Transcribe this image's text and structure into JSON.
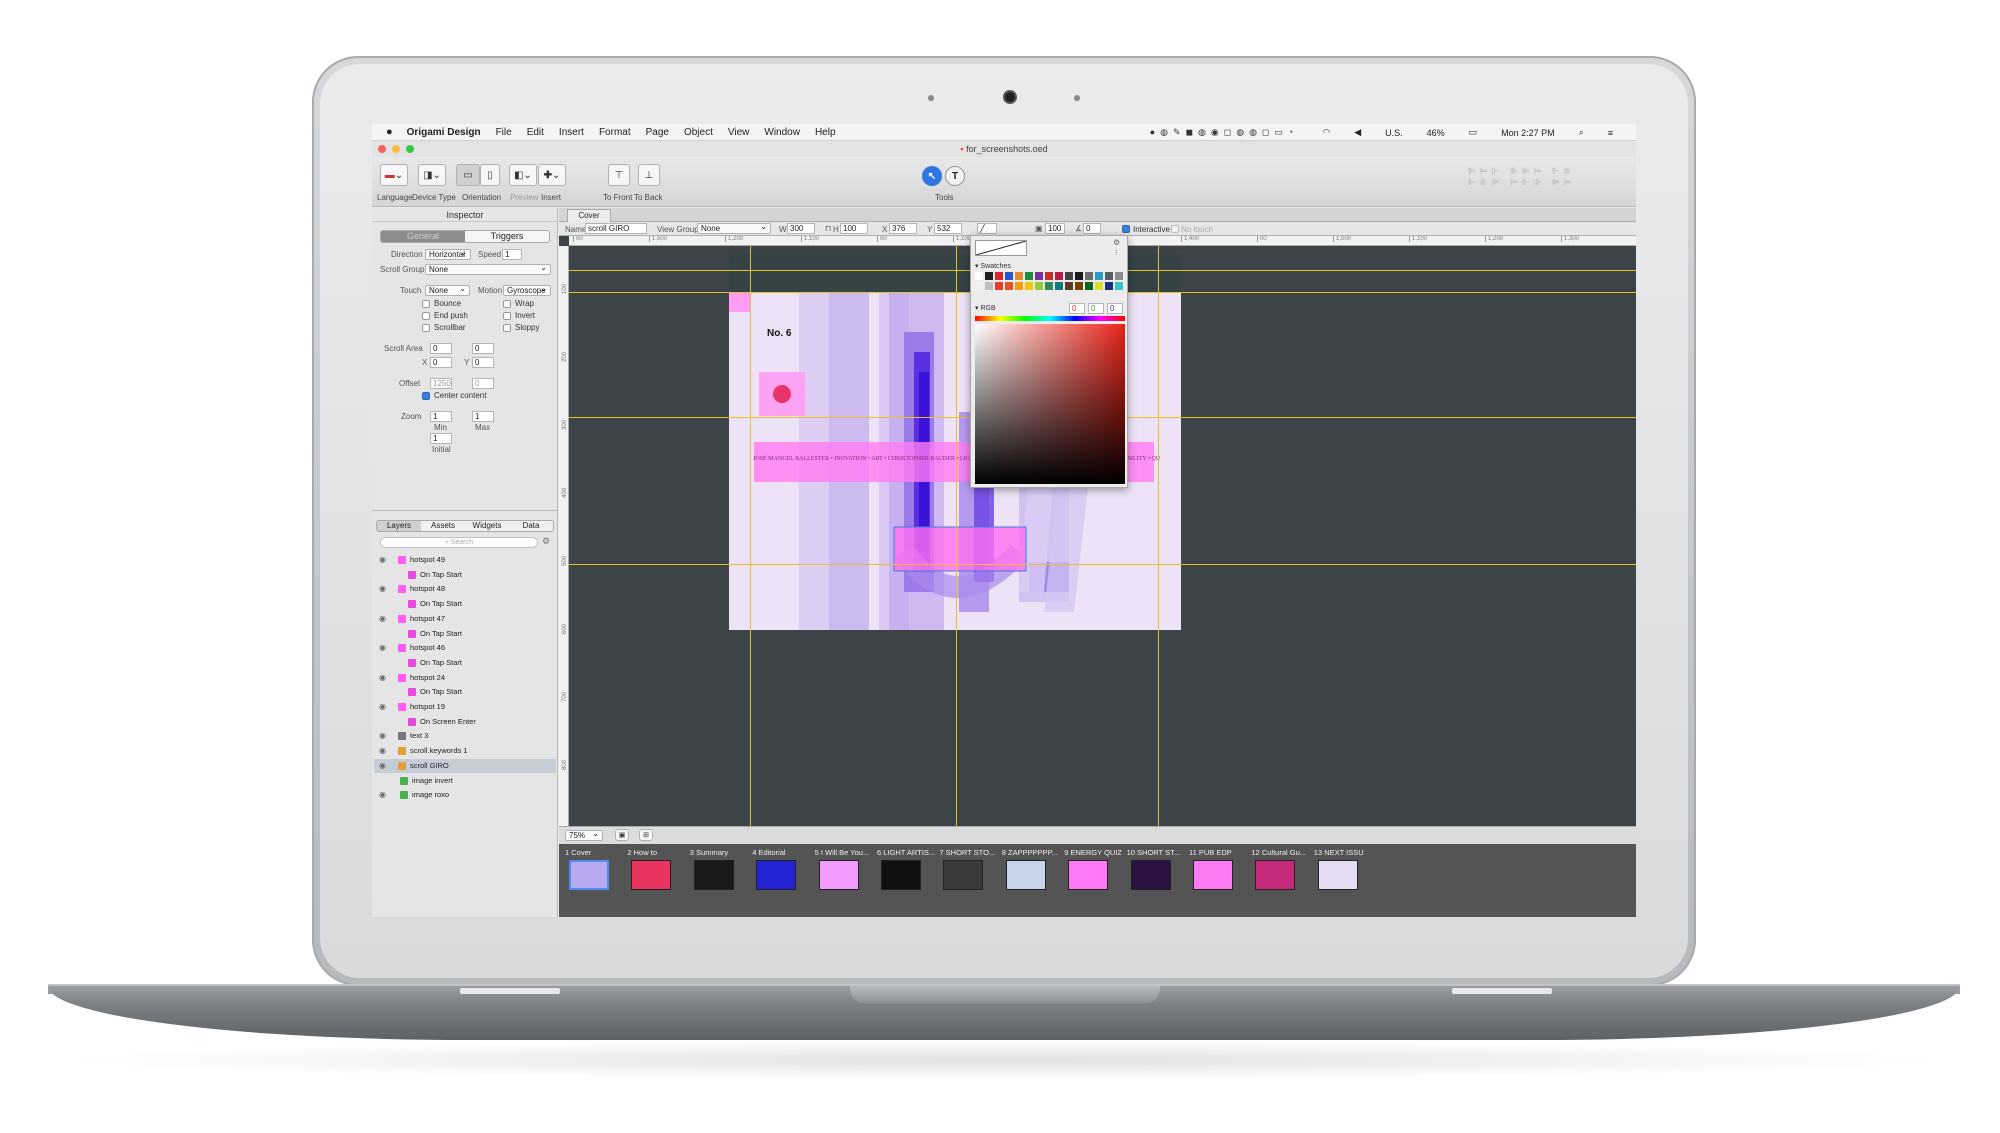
{
  "menubar": {
    "apple": "",
    "app_name": "Origami Design",
    "items": [
      "File",
      "Edit",
      "Insert",
      "Format",
      "Page",
      "Object",
      "View",
      "Window",
      "Help"
    ],
    "status": {
      "locale": "U.S.",
      "battery": "46%",
      "clock": "Mon 2:27 PM"
    }
  },
  "window": {
    "title": "for_screenshots.oed"
  },
  "toolbar": {
    "language": "Language",
    "device_type": "Device Type",
    "orientation": "Orientation",
    "preview": "Preview",
    "insert": "Insert",
    "to_front": "To Front",
    "to_back": "To Back",
    "tools": "Tools",
    "text_tool": "T"
  },
  "inspector": {
    "title": "Inspector",
    "tabs": [
      "General",
      "Triggers"
    ],
    "direction_label": "Direction",
    "direction_value": "Horizontal",
    "speed_label": "Speed",
    "speed_value": "1",
    "scroll_group_label": "Scroll Group",
    "scroll_group_value": "None",
    "touch_label": "Touch",
    "touch_value": "None",
    "motion_label": "Motion",
    "motion_value": "Gyroscope",
    "checks_left": [
      "Bounce",
      "End push",
      "Scrollbar"
    ],
    "checks_right": [
      "Wrap",
      "Invert",
      "Sloppy"
    ],
    "scroll_area_label": "Scroll Area",
    "sa_w": "0",
    "sa_h": "0",
    "x_label": "X",
    "x_value": "0",
    "y_label": "Y",
    "y_value": "0",
    "offset_label": "Offset",
    "offset_x": "1250",
    "offset_y": "0",
    "center_content": "Center content",
    "zoom_label": "Zoom",
    "zoom_min": "1",
    "zoom_max": "1",
    "min_label": "Min",
    "max_label": "Max",
    "zoom_initial": "1",
    "initial_label": "Initial"
  },
  "layers_panel": {
    "tabs": [
      "Layers",
      "Assets",
      "Widgets",
      "Data"
    ],
    "search_placeholder": "Search",
    "rows": [
      {
        "name": "hotspot 49",
        "type": "hotspot"
      },
      {
        "name": "On Tap Start",
        "type": "trigger"
      },
      {
        "name": "hotspot 48",
        "type": "hotspot"
      },
      {
        "name": "On Tap Start",
        "type": "trigger"
      },
      {
        "name": "hotspot 47",
        "type": "hotspot"
      },
      {
        "name": "On Tap Start",
        "type": "trigger"
      },
      {
        "name": "hotspot 46",
        "type": "hotspot"
      },
      {
        "name": "On Tap Start",
        "type": "trigger"
      },
      {
        "name": "hotspot 24",
        "type": "hotspot"
      },
      {
        "name": "On Tap Start",
        "type": "trigger"
      },
      {
        "name": "hotspot 19",
        "type": "hotspot"
      },
      {
        "name": "On Screen Enter",
        "type": "trigger"
      },
      {
        "name": "text 3",
        "type": "text"
      },
      {
        "name": "scroll.keywords 1",
        "type": "folder"
      },
      {
        "name": "scroll GIRO",
        "type": "scroll"
      },
      {
        "name": "image invert",
        "type": "image"
      },
      {
        "name": "image roxo",
        "type": "image"
      }
    ]
  },
  "canvas": {
    "tab": "Cover",
    "name_label": "Name",
    "name_value": "scroll GIRO",
    "view_group_label": "View Group",
    "view_group_value": "None",
    "w_label": "W",
    "w_value": "300",
    "h_label": "H",
    "h_value": "100",
    "x_label": "X",
    "x_value": "376",
    "y_label": "Y",
    "y_value": "532",
    "opacity_value": "100",
    "rotation_value": "0",
    "interactive_label": "Interactive",
    "no_touch_label": "No touch",
    "ruler_h": [
      "00",
      "1,500",
      "1,200",
      "1,100",
      "00",
      "1,100",
      "1,200",
      "1,300",
      "1,400",
      "00",
      "1,000",
      "1,100",
      "1,200",
      "1,300"
    ],
    "ruler_v": [
      "100",
      "200",
      "300",
      "400",
      "500",
      "600",
      "700",
      "800"
    ],
    "artboard_text": "No. 6",
    "marquee_text": "JOSÉ MANUEL BALLESTER • INOVATION • ART • CHRISTOPHER BAUDER • LIGH",
    "marquee_tail": "BILITY • QU",
    "zoom": "75%"
  },
  "color_picker": {
    "swatches_label": "Swatches",
    "rgb_label": "RGB",
    "r": "0",
    "g": "0",
    "b": "0",
    "swatch_row1": [
      "#ffffff",
      "#222222",
      "#d8262a",
      "#2457c8",
      "#e58b2e",
      "#1e8e3e",
      "#7a2fa0",
      "#c9302c",
      "#b91d47",
      "#444444",
      "#1a1a1a",
      "#6d6d6d",
      "#2c9ac9",
      "#555e64",
      "#8a8a8a"
    ],
    "swatch_row2": [
      "#f2f2f2",
      "#bfbfbf",
      "#e63b2e",
      "#e8512a",
      "#f39c12",
      "#f1c40f",
      "#98c93c",
      "#2e8b57",
      "#127a7a",
      "#5b3a1f",
      "#7b3f00",
      "#0b6623",
      "#dcdc2a",
      "#1c2f7a",
      "#33c3c9"
    ]
  },
  "pages": [
    {
      "label": "1 Cover",
      "color": "#b8a9f0"
    },
    {
      "label": "2 How to",
      "color": "#e8345e"
    },
    {
      "label": "3 Summary",
      "color": "#1a1a1a"
    },
    {
      "label": "4 Editorial",
      "color": "#2424d6"
    },
    {
      "label": "5 I Will Be You...",
      "color": "#f29bff"
    },
    {
      "label": "6 LIGHT ARTIS...",
      "color": "#111111"
    },
    {
      "label": "7 SHORT STO...",
      "color": "#3a3a3a"
    },
    {
      "label": "8 ZAPPPPPPP...",
      "color": "#c8d4e8"
    },
    {
      "label": "9 ENERGY QUIZ",
      "color": "#ff78f5"
    },
    {
      "label": "10 SHORT ST...",
      "color": "#2a1240"
    },
    {
      "label": "11 PUB EDP",
      "color": "#ff7af4"
    },
    {
      "label": "12 Cultural Gu...",
      "color": "#c62a7a"
    },
    {
      "label": "13 NEXT ISSU",
      "color": "#e6dcf3"
    }
  ],
  "colors": {
    "accent": "#3b7fe0",
    "guide": "#e7c02a",
    "hotspot": "#ff5cf5",
    "canvas_bg": "#3d4447"
  }
}
